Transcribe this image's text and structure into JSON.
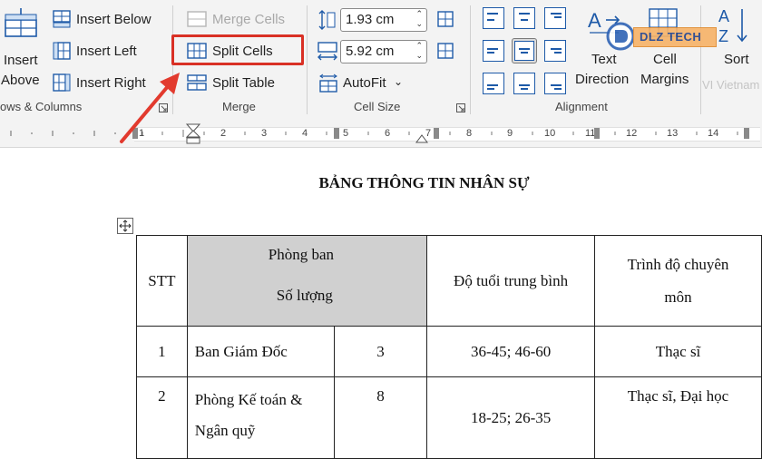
{
  "ribbon": {
    "rows_columns": {
      "insert_above_line1": "Insert",
      "insert_above_line2": "Above",
      "insert_below": "Insert Below",
      "insert_left": "Insert Left",
      "insert_right": "Insert Right",
      "group_label": "ows & Columns"
    },
    "merge": {
      "merge_cells": "Merge Cells",
      "split_cells": "Split Cells",
      "split_table": "Split Table",
      "group_label": "Merge"
    },
    "cell_size": {
      "height_value": "1.93 cm",
      "width_value": "5.92 cm",
      "autofit": "AutoFit",
      "group_label": "Cell Size"
    },
    "alignment": {
      "text_direction_line1": "Text",
      "text_direction_line2": "Direction",
      "cell_margins_line1": "Cell",
      "cell_margins_line2": "Margins",
      "group_label": "Alignment"
    },
    "sort": "Sort",
    "watermark": {
      "brand": "DLZ TECH",
      "tagline": "VI Vietnam"
    }
  },
  "ruler": {
    "numbers": [
      "1",
      "2",
      "3",
      "4",
      "5",
      "6",
      "7",
      "8",
      "9",
      "10",
      "11",
      "12",
      "13",
      "14"
    ]
  },
  "document": {
    "title": "BẢNG THÔNG TIN NHÂN SỰ",
    "table": {
      "header": {
        "stt": "STT",
        "phong_ban": "Phòng ban",
        "so_luong": "Số lượng",
        "do_tuoi": "Độ tuổi trung bình",
        "trinh_do_line1": "Trình độ chuyên",
        "trinh_do_line2": "môn"
      },
      "rows": [
        {
          "stt": "1",
          "phong_ban": "Ban Giám Đốc",
          "so_luong": "3",
          "do_tuoi": "36-45; 46-60",
          "trinh_do": "Thạc sĩ"
        },
        {
          "stt": "2",
          "phong_ban_line1": "Phòng Kế toán &",
          "phong_ban_line2": "Ngân quỹ",
          "so_luong": "8",
          "do_tuoi": "18-25; 26-35",
          "trinh_do": "Thạc sĩ, Đại học"
        }
      ]
    }
  },
  "colors": {
    "highlight_box": "#d93025",
    "arrow": "#e23a2e",
    "merged_header_bg": "#d0d0d0",
    "icon_blue": "#1e5aa8"
  }
}
